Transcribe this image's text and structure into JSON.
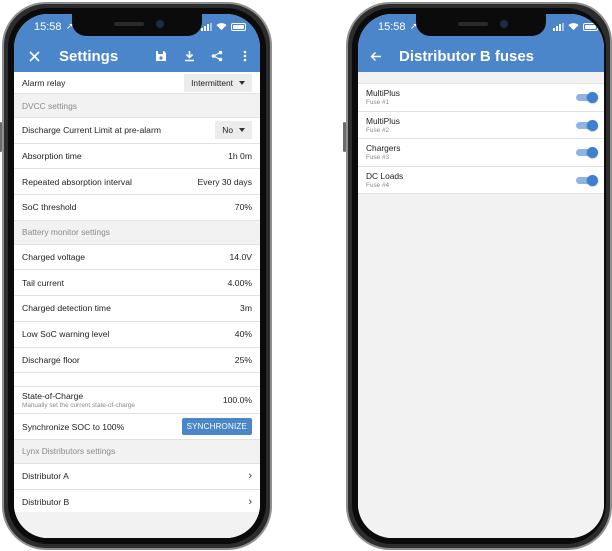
{
  "status": {
    "time_left": "15:58",
    "time_right": "15:58"
  },
  "settings": {
    "title": "Settings",
    "alarm_relay": {
      "label": "Alarm relay",
      "value": "Intermittent"
    },
    "dvcc_header": "DVCC settings",
    "dvcc_rows": {
      "discharge_limit": {
        "label": "Discharge Current Limit at pre-alarm",
        "value": "No"
      },
      "absorption_time": {
        "label": "Absorption time",
        "value": "1h 0m"
      },
      "repeated_absorption": {
        "label": "Repeated absorption interval",
        "value": "Every 30 days"
      },
      "soc_threshold": {
        "label": "SoC threshold",
        "value": "70%"
      }
    },
    "battery_header": "Battery monitor settings",
    "battery_rows": {
      "charged_voltage": {
        "label": "Charged voltage",
        "value": "14.0V"
      },
      "tail_current": {
        "label": "Tail current",
        "value": "4.00%"
      },
      "charged_detection": {
        "label": "Charged detection time",
        "value": "3m"
      },
      "low_soc": {
        "label": "Low SoC warning level",
        "value": "40%"
      },
      "discharge_floor": {
        "label": "Discharge floor",
        "value": "25%"
      }
    },
    "state_of_charge": {
      "label": "State-of-Charge",
      "sublabel": "Manually set the current state-of-charge",
      "value": "100.0%"
    },
    "sync_soc": {
      "label": "Synchronize SOC to 100%",
      "button": "SYNCHRONIZE"
    },
    "lynx_header": "Lynx Distributors settings",
    "lynx_rows": {
      "distributor_a": {
        "label": "Distributor A"
      },
      "distributor_b": {
        "label": "Distributor B"
      }
    }
  },
  "fuses": {
    "title": "Distributor B fuses",
    "items": [
      {
        "name": "MultiPlus",
        "fuse": "Fuse #1",
        "enabled": true
      },
      {
        "name": "MultiPlus",
        "fuse": "Fuse #2",
        "enabled": true
      },
      {
        "name": "Chargers",
        "fuse": "Fuse #3",
        "enabled": true
      },
      {
        "name": "DC Loads",
        "fuse": "Fuse #4",
        "enabled": true
      }
    ]
  },
  "colors": {
    "accent": "#4a86c9",
    "toggle_knob": "#3d7fd0",
    "toggle_track": "#8db4e2",
    "section_bg": "#f2f2f2"
  },
  "icons": {
    "left_toolbar": [
      "close-icon",
      "save-icon",
      "download-icon",
      "share-icon",
      "more-vert-icon"
    ],
    "right_toolbar": [
      "arrow-back-icon"
    ],
    "status": [
      "location-arrow-icon",
      "signal-icon",
      "wifi-icon",
      "battery-icon"
    ]
  }
}
